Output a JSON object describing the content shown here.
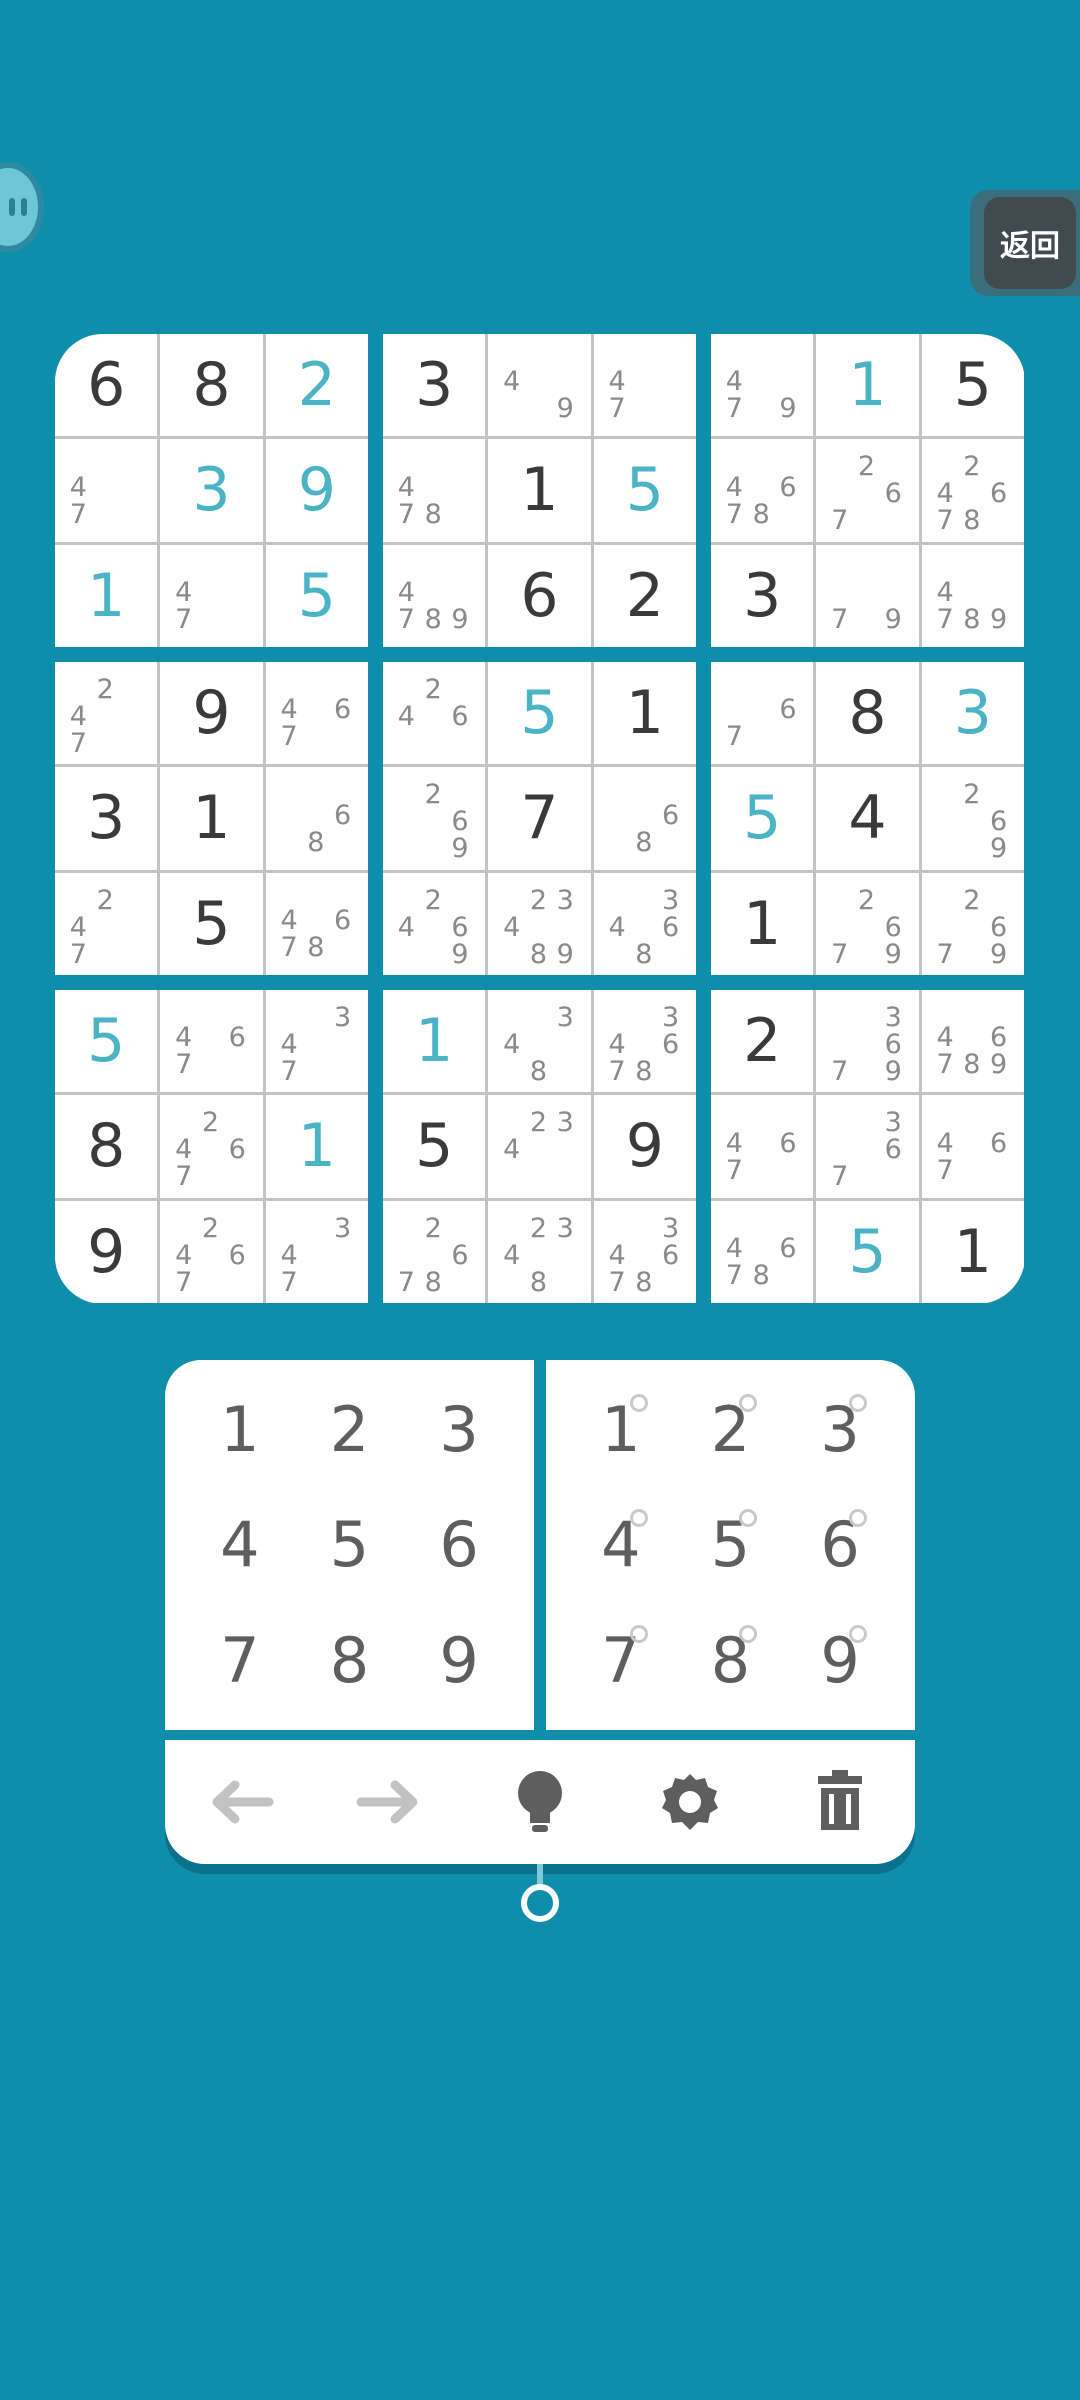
{
  "colors": {
    "background": "#0f8eab",
    "user_digit": "#4ab3c5",
    "given_digit": "#3a3a3a",
    "note": "#8a8a8a"
  },
  "back_button": {
    "label": "返回"
  },
  "board": [
    [
      [
        {
          "v": "6",
          "t": "given"
        },
        {
          "v": "8",
          "t": "given"
        },
        {
          "v": "2",
          "t": "user"
        }
      ],
      [
        {
          "n": [
            4,
            7
          ]
        },
        {
          "v": "3",
          "t": "user"
        },
        {
          "v": "9",
          "t": "user"
        }
      ],
      [
        {
          "v": "1",
          "t": "user"
        },
        {
          "n": [
            4,
            7
          ]
        },
        {
          "v": "5",
          "t": "user"
        }
      ]
    ],
    [
      [
        {
          "v": "3",
          "t": "given"
        },
        {
          "n": [
            4,
            9
          ]
        },
        {
          "n": [
            4,
            7
          ]
        }
      ],
      [
        {
          "n": [
            4,
            7,
            8
          ]
        },
        {
          "v": "1",
          "t": "given"
        },
        {
          "v": "5",
          "t": "user"
        }
      ],
      [
        {
          "n": [
            4,
            7,
            8,
            9
          ]
        },
        {
          "v": "6",
          "t": "given"
        },
        {
          "v": "2",
          "t": "given"
        }
      ]
    ],
    [
      [
        {
          "n": [
            4,
            7,
            9
          ]
        },
        {
          "v": "1",
          "t": "user"
        },
        {
          "v": "5",
          "t": "given"
        }
      ],
      [
        {
          "n": [
            4,
            6,
            7,
            8
          ]
        },
        {
          "n": [
            2,
            6,
            7
          ]
        },
        {
          "n": [
            2,
            4,
            6,
            7,
            8
          ]
        }
      ],
      [
        {
          "v": "3",
          "t": "given"
        },
        {
          "n": [
            7,
            9
          ]
        },
        {
          "n": [
            4,
            7,
            8,
            9
          ]
        }
      ]
    ],
    [
      [
        {
          "n": [
            2,
            4,
            7
          ]
        },
        {
          "v": "9",
          "t": "given"
        },
        {
          "n": [
            4,
            6,
            7
          ]
        }
      ],
      [
        {
          "v": "3",
          "t": "given"
        },
        {
          "v": "1",
          "t": "given"
        },
        {
          "n": [
            6,
            8
          ]
        }
      ],
      [
        {
          "n": [
            2,
            4,
            7
          ]
        },
        {
          "v": "5",
          "t": "given"
        },
        {
          "n": [
            4,
            6,
            7,
            8
          ]
        }
      ]
    ],
    [
      [
        {
          "n": [
            2,
            4,
            6
          ]
        },
        {
          "v": "5",
          "t": "user"
        },
        {
          "v": "1",
          "t": "given"
        }
      ],
      [
        {
          "n": [
            2,
            6,
            9
          ]
        },
        {
          "v": "7",
          "t": "given"
        },
        {
          "n": [
            6,
            8
          ]
        }
      ],
      [
        {
          "n": [
            2,
            4,
            6,
            9
          ]
        },
        {
          "n": [
            2,
            3,
            4,
            8,
            9
          ]
        },
        {
          "n": [
            3,
            4,
            6,
            8
          ]
        }
      ]
    ],
    [
      [
        {
          "n": [
            6,
            7
          ]
        },
        {
          "v": "8",
          "t": "given"
        },
        {
          "v": "3",
          "t": "user"
        }
      ],
      [
        {
          "v": "5",
          "t": "user"
        },
        {
          "v": "4",
          "t": "given"
        },
        {
          "n": [
            2,
            6,
            9
          ]
        }
      ],
      [
        {
          "v": "1",
          "t": "given"
        },
        {
          "n": [
            2,
            6,
            7,
            9
          ]
        },
        {
          "n": [
            2,
            6,
            7,
            9
          ]
        }
      ]
    ],
    [
      [
        {
          "v": "5",
          "t": "user"
        },
        {
          "n": [
            4,
            6,
            7
          ]
        },
        {
          "n": [
            3,
            4,
            7
          ]
        }
      ],
      [
        {
          "v": "8",
          "t": "given"
        },
        {
          "n": [
            2,
            4,
            6,
            7
          ]
        },
        {
          "v": "1",
          "t": "user"
        }
      ],
      [
        {
          "v": "9",
          "t": "given"
        },
        {
          "n": [
            2,
            4,
            6,
            7
          ]
        },
        {
          "n": [
            3,
            4,
            7
          ]
        }
      ]
    ],
    [
      [
        {
          "v": "1",
          "t": "user"
        },
        {
          "n": [
            3,
            4,
            8
          ]
        },
        {
          "n": [
            3,
            4,
            6,
            7,
            8
          ]
        }
      ],
      [
        {
          "v": "5",
          "t": "given"
        },
        {
          "n": [
            2,
            3,
            4
          ]
        },
        {
          "v": "9",
          "t": "given"
        }
      ],
      [
        {
          "n": [
            2,
            6,
            7,
            8
          ]
        },
        {
          "n": [
            2,
            3,
            4,
            8
          ]
        },
        {
          "n": [
            3,
            4,
            6,
            7,
            8
          ]
        }
      ]
    ],
    [
      [
        {
          "v": "2",
          "t": "given"
        },
        {
          "n": [
            3,
            6,
            7,
            9
          ]
        },
        {
          "n": [
            4,
            6,
            7,
            8,
            9
          ]
        }
      ],
      [
        {
          "n": [
            4,
            6,
            7
          ]
        },
        {
          "n": [
            3,
            6,
            7
          ]
        },
        {
          "n": [
            4,
            6,
            7
          ]
        }
      ],
      [
        {
          "n": [
            4,
            6,
            7,
            8
          ]
        },
        {
          "v": "5",
          "t": "user"
        },
        {
          "v": "1",
          "t": "given"
        }
      ]
    ]
  ],
  "numpad": {
    "digits": [
      "1",
      "2",
      "3",
      "4",
      "5",
      "6",
      "7",
      "8",
      "9"
    ],
    "note_digits": [
      "1",
      "2",
      "3",
      "4",
      "5",
      "6",
      "7",
      "8",
      "9"
    ]
  },
  "toolbar": {
    "icons": [
      "undo-arrow-icon",
      "redo-arrow-icon",
      "hint-bulb-icon",
      "settings-gear-icon",
      "erase-trash-icon"
    ]
  }
}
